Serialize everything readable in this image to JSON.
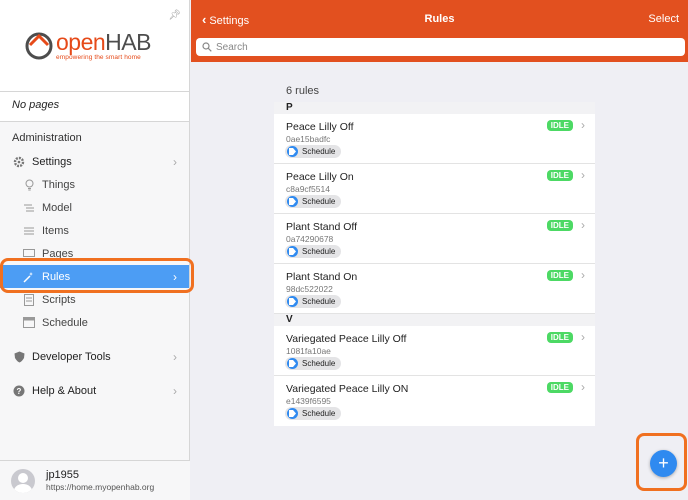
{
  "sidebar": {
    "logo": {
      "brand_open": "open",
      "brand_hab": "HAB",
      "tagline": "empowering the smart home"
    },
    "no_pages": "No pages",
    "section_admin": "Administration",
    "settings": "Settings",
    "sub_items": [
      {
        "label": "Things",
        "icon": "bulb-icon"
      },
      {
        "label": "Model",
        "icon": "list-icon"
      },
      {
        "label": "Items",
        "icon": "items-icon"
      },
      {
        "label": "Pages",
        "icon": "display-icon"
      }
    ],
    "rules": "Rules",
    "scripts": "Scripts",
    "schedule": "Schedule",
    "developer_tools": "Developer Tools",
    "help_about": "Help & About",
    "user": {
      "name": "jp1955",
      "url": "https://home.myopenhab.org"
    }
  },
  "header": {
    "back_label": "Settings",
    "title": "Rules",
    "select_label": "Select",
    "search_placeholder": "Search"
  },
  "list": {
    "count": "6 rules",
    "groups": [
      {
        "letter": "P",
        "rules": [
          {
            "name": "Peace Lilly Off",
            "id": "0ae15badfc",
            "tag": "Schedule",
            "status": "IDLE"
          },
          {
            "name": "Peace Lilly On",
            "id": "c8a9cf5514",
            "tag": "Schedule",
            "status": "IDLE"
          },
          {
            "name": "Plant Stand Off",
            "id": "0a74290678",
            "tag": "Schedule",
            "status": "IDLE"
          },
          {
            "name": "Plant Stand On",
            "id": "98dc522022",
            "tag": "Schedule",
            "status": "IDLE"
          }
        ]
      },
      {
        "letter": "V",
        "rules": [
          {
            "name": "Variegated Peace Lilly Off",
            "id": "1081fa10ae",
            "tag": "Schedule",
            "status": "IDLE"
          },
          {
            "name": "Variegated Peace Lilly ON",
            "id": "e1439f6595",
            "tag": "Schedule",
            "status": "IDLE"
          }
        ]
      }
    ]
  },
  "fab": {
    "label": "+"
  },
  "colors": {
    "header": "#e2501f",
    "active": "#4c9df4",
    "highlight": "#f07020",
    "idle": "#4cd964",
    "fab": "#2f8af0"
  }
}
